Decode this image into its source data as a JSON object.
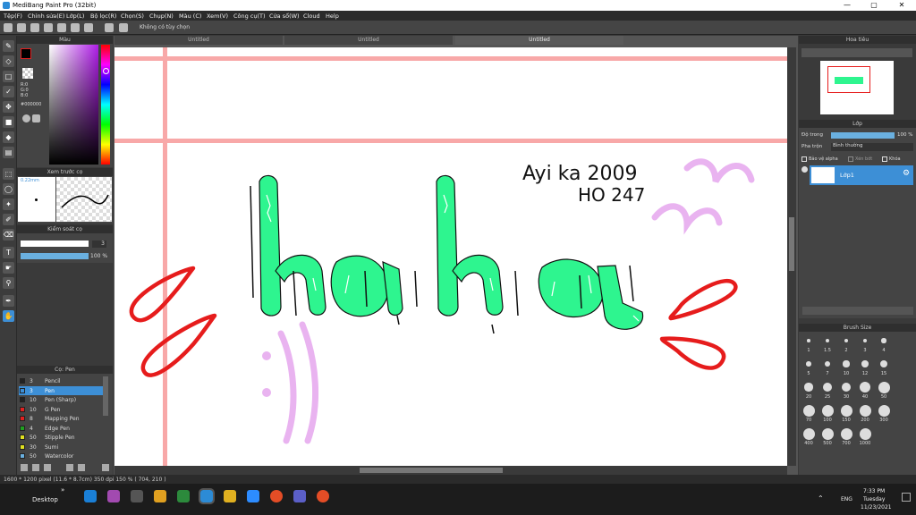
{
  "window": {
    "title": "MediBang Paint Pro (32bit)",
    "minimize": "—",
    "maximize": "▢",
    "close": "✕"
  },
  "menu": [
    "Tệp(F)",
    "Chỉnh sửa(E)",
    "Lớp(L)",
    "Bộ lọc(R)",
    "Chọn(S)",
    "Chụp(N)",
    "Màu (C)",
    "Xem(V)",
    "Công cụ(T)",
    "Cửa sổ(W)",
    "Cloud",
    "Help"
  ],
  "toolbar": {
    "hint": "Không có tùy chọn"
  },
  "tabs": [
    "Untitled",
    "Untitled",
    "Untitled"
  ],
  "color_panel": {
    "title": "Màu",
    "r": "R:0",
    "g": "G:0",
    "b": "B:0",
    "hex": "#000000",
    "fg": "#000000",
    "bg": "#ffffff"
  },
  "brush_preview": {
    "title": "Xem trước cọ",
    "size": "0.22mm"
  },
  "control": {
    "title": "Kiểm soát cọ",
    "size": "3",
    "opacity": "100 %"
  },
  "brush_list": {
    "title": "Cọ: Pen",
    "items": [
      {
        "num": "3",
        "name": "Pencil",
        "color": "#222222"
      },
      {
        "num": "3",
        "name": "Pen",
        "color": "#3d8fd6",
        "selected": true
      },
      {
        "num": "10",
        "name": "Pen (Sharp)",
        "color": "#222222"
      },
      {
        "num": "10",
        "name": "G Pen",
        "color": "#e02020"
      },
      {
        "num": "8",
        "name": "Mapping Pen",
        "color": "#e02020"
      },
      {
        "num": "4",
        "name": "Edge Pen",
        "color": "#20a020"
      },
      {
        "num": "50",
        "name": "Stipple Pen",
        "color": "#e0e020"
      },
      {
        "num": "30",
        "name": "Sumi",
        "color": "#e0e020"
      },
      {
        "num": "50",
        "name": "Watercolor",
        "color": "#6ab0e0"
      }
    ]
  },
  "navigator": {
    "title": "Hoa tiêu"
  },
  "layers": {
    "title": "Lớp",
    "opacity_label": "Độ trong",
    "opacity": "100 %",
    "blend_label": "Pha trộn",
    "blend": "Bình thường",
    "protect_alpha": "Bảo vệ alpha",
    "clip": "Xén bớt",
    "lock": "Khóa",
    "layer_name": "Lớp1"
  },
  "brush_size": {
    "title": "Brush Size",
    "sizes": [
      "1",
      "1.5",
      "2",
      "3",
      "4",
      "5",
      "7",
      "10",
      "12",
      "15",
      "20",
      "25",
      "30",
      "40",
      "50",
      "70",
      "100",
      "150",
      "200",
      "300",
      "400",
      "500",
      "700",
      "1000"
    ]
  },
  "artwork": {
    "main_text": "haha",
    "signature_1": "Ayi ka 2009",
    "signature_2": "HO 247",
    "accent": "#2ef58f",
    "red": "#e61c1c",
    "lilac": "#e9b3f0"
  },
  "status": {
    "text": "1600 * 1200 pixel   (11.6 * 8.7cm)   350 dpi   150 %   ( 704, 210 )"
  },
  "taskbar": {
    "desktop": "Desktop",
    "lang": "ENG",
    "time": "7:33 PM",
    "day": "Tuesday",
    "date": "11/23/2021"
  }
}
